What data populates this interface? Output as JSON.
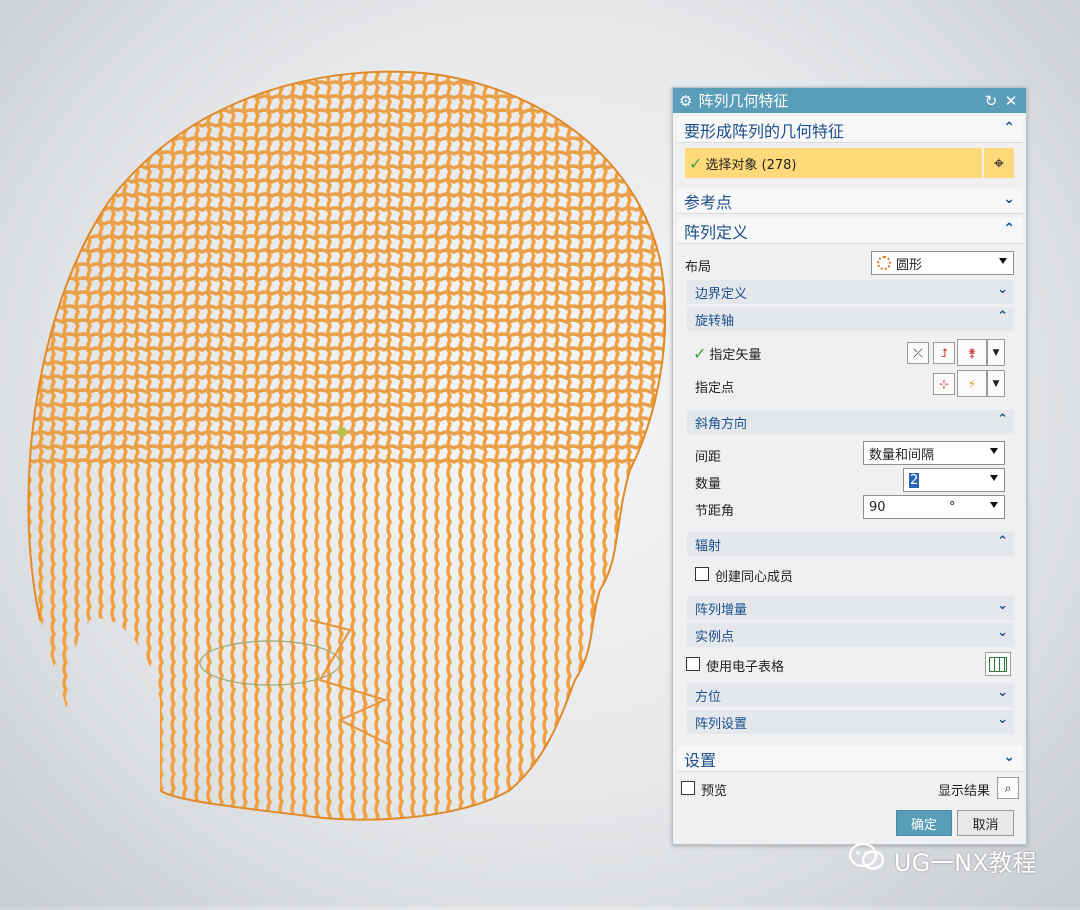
{
  "dialog": {
    "title": "阵列几何特征",
    "section_geometry": {
      "title": "要形成阵列的几何特征",
      "select_label": "选择对象 (278)"
    },
    "section_reference": {
      "title": "参考点"
    },
    "section_array_def": {
      "title": "阵列定义",
      "layout_label": "布局",
      "layout_value": "圆形",
      "boundary": "边界定义",
      "rotation_axis": {
        "title": "旋转轴",
        "vector_label": "指定矢量",
        "point_label": "指定点"
      },
      "angular": {
        "title": "斜角方向",
        "spacing_label": "间距",
        "spacing_value": "数量和间隔",
        "count_label": "数量",
        "count_value": "2",
        "pitch_label": "节距角",
        "pitch_value": "90",
        "pitch_unit": "°"
      },
      "radial": {
        "title": "辐射",
        "concentric_label": "创建同心成员"
      },
      "increment": "阵列增量",
      "instance_points": "实例点",
      "spreadsheet_label": "使用电子表格",
      "orientation": "方位",
      "array_settings": "阵列设置"
    },
    "section_settings": {
      "title": "设置"
    },
    "preview_label": "预览",
    "show_result_label": "显示结果",
    "ok_label": "确定",
    "cancel_label": "取消"
  },
  "watermark": "UG一NX教程",
  "colors": {
    "title_bar": "#5a9db9",
    "header_text": "#1d4f8a",
    "selection_highlight": "#ffd97a",
    "ok_button": "#5a9db9",
    "model_orange": "#f0a040"
  }
}
